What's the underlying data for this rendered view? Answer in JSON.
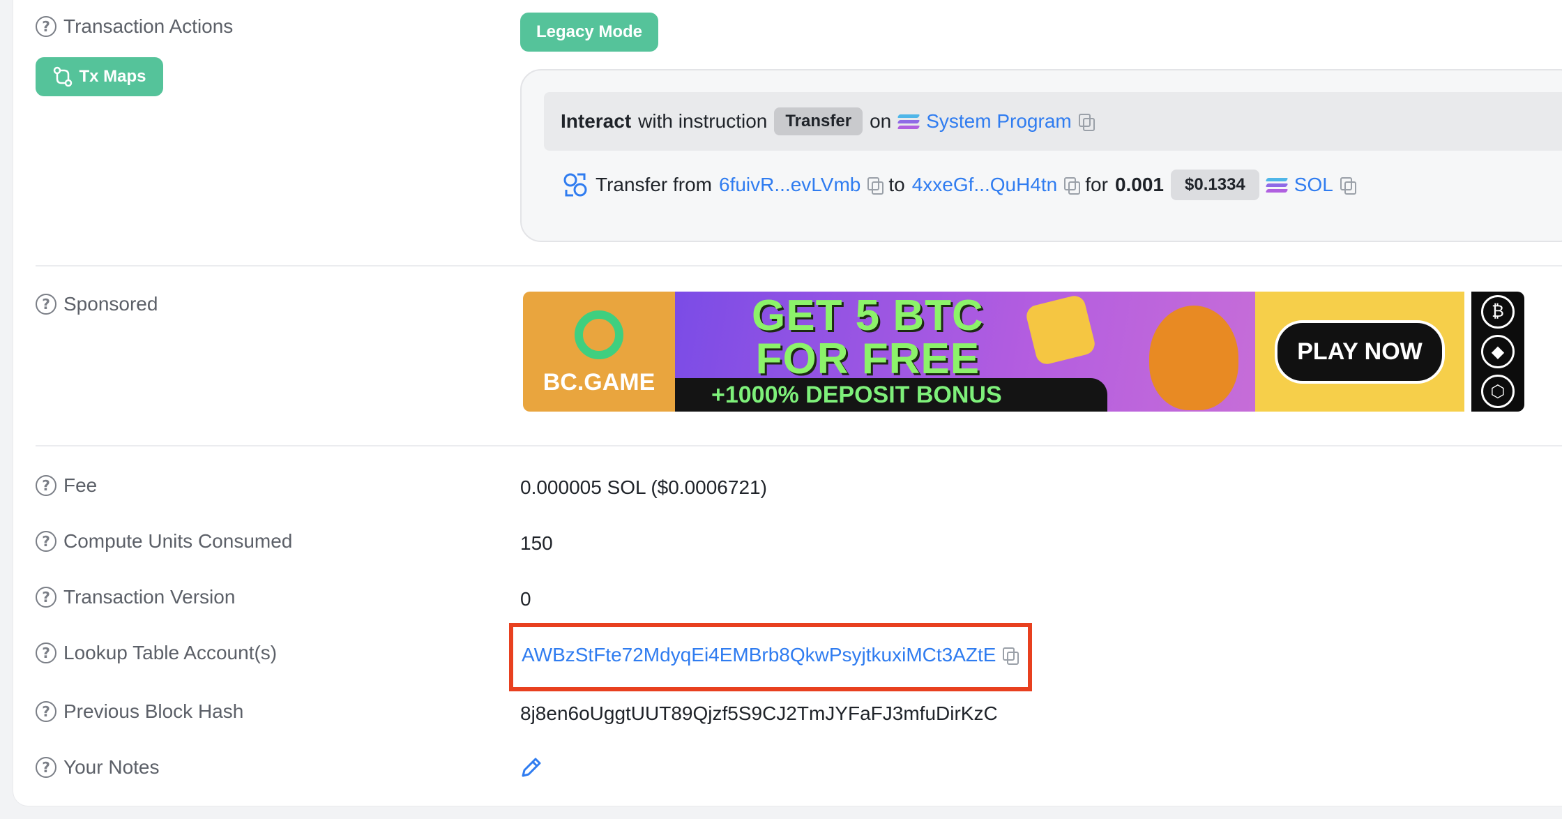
{
  "colors": {
    "accent_green": "#55c39a",
    "link_blue": "#2f7cf0",
    "highlight_red": "#e8401f"
  },
  "labels": {
    "transaction_actions": "Transaction Actions",
    "sponsored": "Sponsored",
    "fee": "Fee",
    "compute_units": "Compute Units Consumed",
    "transaction_version": "Transaction Version",
    "lookup_table": "Lookup Table Account(s)",
    "previous_block_hash": "Previous Block Hash",
    "your_notes": "Your Notes"
  },
  "buttons": {
    "legacy_mode": "Legacy Mode",
    "tx_maps": "Tx Maps"
  },
  "instruction": {
    "interact": "Interact",
    "with_instruction": "with instruction",
    "name": "Transfer",
    "on": "on",
    "program": "System Program"
  },
  "transfer": {
    "prefix": "Transfer from",
    "from": "6fuivR...evLVmb",
    "to_word": "to",
    "to": "4xxeGf...QuH4tn",
    "for_word": "for",
    "amount": "0.001",
    "usd": "$0.1334",
    "token": "SOL"
  },
  "ad": {
    "brand": "BC.GAME",
    "headline_1": "GET 5 BTC",
    "headline_2": "FOR FREE",
    "bonus": "+1000% DEPOSIT BONUS",
    "cta": "PLAY NOW"
  },
  "values": {
    "fee": "0.000005 SOL ($0.0006721)",
    "compute_units": "150",
    "transaction_version": "0",
    "lookup_table": "AWBzStFte72MdyqEi4EMBrb8QkwPsyjtkuxiMCt3AZtE",
    "previous_block_hash": "8j8en6oUggtUUT89Qjzf5S9CJ2TmJYFaFJ3mfuDirKzC"
  },
  "icons": {
    "help": "question-circle-icon",
    "copy": "copy-icon",
    "pencil": "pencil-icon",
    "transfer": "transfer-arrows-icon",
    "tx_maps": "flow-map-icon",
    "solana": "solana-logo-icon"
  }
}
